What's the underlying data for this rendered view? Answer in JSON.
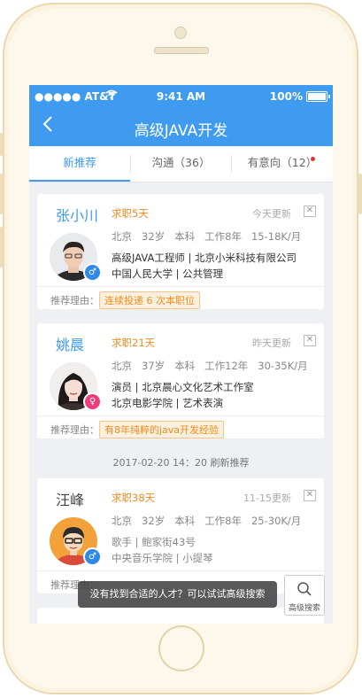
{
  "status_bar": {
    "carrier": "●●●●● AT&T",
    "time": "9:41 AM",
    "battery": "100%",
    "battery_level": 1.0
  },
  "nav": {
    "title": "高级JAVA开发"
  },
  "tabs": [
    {
      "label": "新推荐"
    },
    {
      "label": "沟通（36）"
    },
    {
      "label": "有意向（12）"
    }
  ],
  "candidates": [
    {
      "name": "张小川",
      "job_status": "求职5天",
      "updated": "今天更新",
      "gender_icon": "male-icon",
      "stats": [
        "北京",
        "32岁",
        "本科",
        "工作8年",
        "15-18K/月"
      ],
      "line1": "高级JAVA工程师 | 北京小米科技有限公司",
      "line2": "中国人民大学 | 公共管理",
      "reason_label": "推荐理由：",
      "reason": "连续投递 6 次本职位"
    },
    {
      "name": "姚晨",
      "job_status": "求职21天",
      "updated": "昨天更新",
      "gender_icon": "female-icon",
      "stats": [
        "北京",
        "37岁",
        "本科",
        "工作12年",
        "30-35K/月"
      ],
      "line1": "演员 | 北京晨心文化艺术工作室",
      "line2": "北京电影学院 | 艺术表演",
      "reason_label": "推荐理由：",
      "reason": "有8年纯粹的java开发经验"
    },
    {
      "name": "汪峰",
      "job_status": "求职38天",
      "updated": "11-15更新",
      "gender_icon": "male-icon",
      "stats": [
        "北京",
        "32岁",
        "本科",
        "工作8年",
        "25-30K/月"
      ],
      "line1": "歌手 | 鲍家街43号",
      "line2": "中央音乐学院 | 小提琴",
      "reason_label": "推荐理由："
    }
  ],
  "divider_text": "2017-02-20  14：20 刷新推荐",
  "toast": "没有找到合适的人才？可以试试高级搜索",
  "advanced_search": {
    "label": "高级搜索"
  }
}
